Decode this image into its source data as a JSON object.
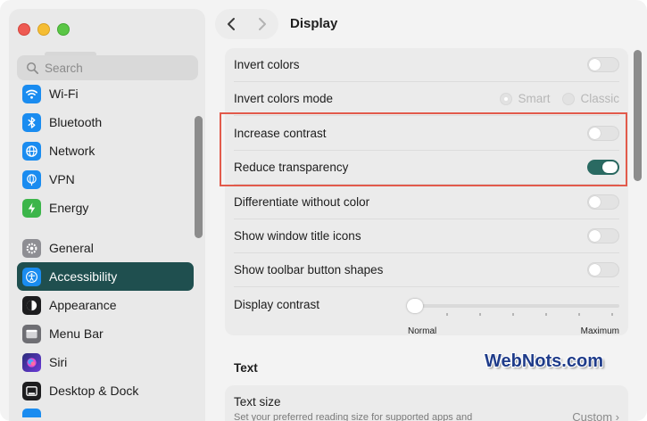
{
  "window": {
    "title": "Display"
  },
  "sidebar": {
    "search_placeholder": "Search",
    "groups": [
      [
        {
          "label": "Wi-Fi",
          "icon": "wifi-icon",
          "color": "#1a8cf0"
        },
        {
          "label": "Bluetooth",
          "icon": "bluetooth-icon",
          "color": "#1a8cf0"
        },
        {
          "label": "Network",
          "icon": "globe-icon",
          "color": "#1a8cf0"
        },
        {
          "label": "VPN",
          "icon": "vpn-globe-icon",
          "color": "#1a8cf0"
        },
        {
          "label": "Energy",
          "icon": "battery-icon",
          "color": "#3cb54a"
        }
      ],
      [
        {
          "label": "General",
          "icon": "gear-icon",
          "color": "#8e8e93"
        },
        {
          "label": "Accessibility",
          "icon": "accessibility-icon",
          "color": "#1a8cf0",
          "active": true
        },
        {
          "label": "Appearance",
          "icon": "appearance-icon",
          "color": "#1d1d1f"
        },
        {
          "label": "Menu Bar",
          "icon": "menu-bar-icon",
          "color": "#6e6e73"
        },
        {
          "label": "Siri",
          "icon": "siri-icon",
          "color": "#6c3bd9"
        },
        {
          "label": "Desktop & Dock",
          "icon": "dock-icon",
          "color": "#1d1d1f"
        }
      ]
    ]
  },
  "settings": {
    "invert_colors": {
      "label": "Invert colors",
      "on": false
    },
    "invert_mode": {
      "label": "Invert colors mode",
      "options": [
        "Smart",
        "Classic"
      ],
      "selected": "Smart"
    },
    "increase_contrast": {
      "label": "Increase contrast",
      "on": false
    },
    "reduce_transparency": {
      "label": "Reduce transparency",
      "on": true
    },
    "differentiate": {
      "label": "Differentiate without color",
      "on": false
    },
    "window_title_icons": {
      "label": "Show window title icons",
      "on": false
    },
    "toolbar_shapes": {
      "label": "Show toolbar button shapes",
      "on": false
    },
    "display_contrast": {
      "label": "Display contrast",
      "min_label": "Normal",
      "max_label": "Maximum",
      "value": 0
    }
  },
  "text_section": {
    "title": "Text",
    "text_size": {
      "label": "Text size",
      "description": "Set your preferred reading size for supported apps and",
      "value": "Custom"
    }
  },
  "watermark": "WebNots.com",
  "colors": {
    "accent": "#1f4f4f",
    "toggle_on": "#2a6a62",
    "highlight": "#e25a4b"
  }
}
